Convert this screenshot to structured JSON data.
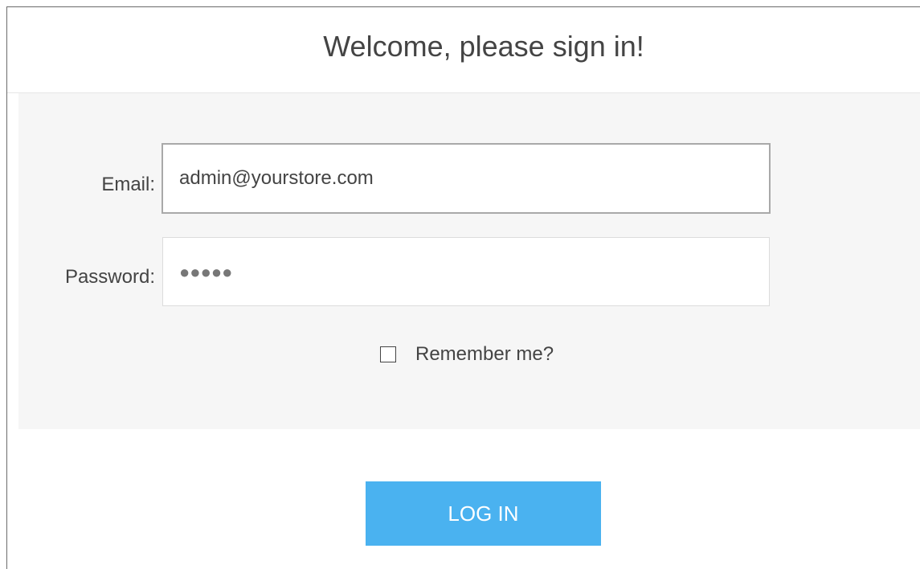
{
  "header": {
    "title": "Welcome, please sign in!"
  },
  "form": {
    "email_label": "Email:",
    "email_value": "admin@yourstore.com",
    "password_label": "Password:",
    "password_mask": "●●●●●",
    "remember_label": "Remember me?",
    "remember_checked": false
  },
  "actions": {
    "login_label": "LOG IN"
  },
  "colors": {
    "accent": "#4ab2f0",
    "panel_bg": "#f6f6f6",
    "text": "#444444"
  },
  "icons": {
    "checkbox": "checkbox-unchecked-icon"
  }
}
